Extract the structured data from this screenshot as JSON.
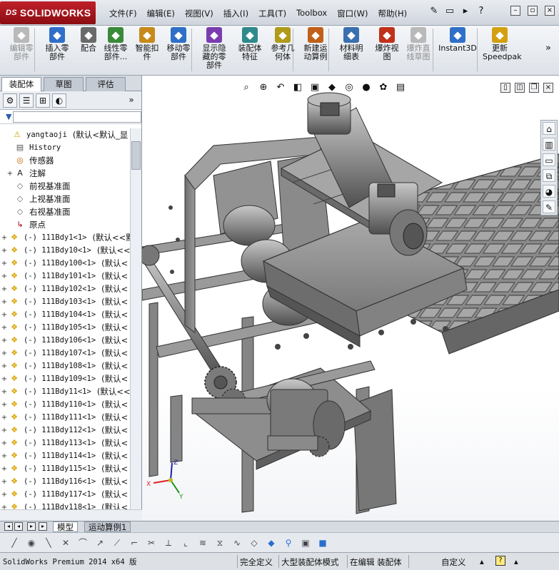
{
  "app": {
    "brand": "SOLIDWORKS",
    "brand_prefix": "DS"
  },
  "menu": [
    "文件(F)",
    "编辑(E)",
    "视图(V)",
    "插入(I)",
    "工具(T)",
    "Toolbox",
    "窗口(W)",
    "帮助(H)"
  ],
  "ribbon": {
    "buttons": [
      {
        "label": "编辑零\n部件",
        "icon": "edit-component-icon",
        "disabled": true
      },
      {
        "label": "插入零\n部件",
        "icon": "insert-component-icon",
        "disabled": false
      },
      {
        "label": "配合",
        "icon": "mate-icon",
        "disabled": false
      },
      {
        "label": "线性零\n部件...",
        "icon": "linear-pattern-icon",
        "disabled": false
      },
      {
        "label": "智能扣\n件",
        "icon": "smart-fastener-icon",
        "disabled": false
      },
      {
        "label": "移动零\n部件",
        "icon": "move-component-icon",
        "disabled": false
      },
      {
        "label": "显示隐\n藏的零\n部件",
        "icon": "show-hidden-icon",
        "disabled": false
      },
      {
        "label": "装配体\n特征",
        "icon": "assembly-feature-icon",
        "disabled": false
      },
      {
        "label": "参考几\n何体",
        "icon": "reference-geometry-icon",
        "disabled": false
      },
      {
        "label": "新建运\n动算例",
        "icon": "new-motion-study-icon",
        "disabled": false
      },
      {
        "label": "材料明\n细表",
        "icon": "bom-icon",
        "disabled": false
      },
      {
        "label": "爆炸视\n图",
        "icon": "exploded-view-icon",
        "disabled": false
      },
      {
        "label": "爆炸直\n线草图",
        "icon": "explode-line-sketch-icon",
        "disabled": true
      },
      {
        "label": "Instant3D",
        "icon": "instant3d-icon",
        "disabled": false
      },
      {
        "label": "更新\nSpeedpak",
        "icon": "speedpak-icon",
        "disabled": false
      }
    ]
  },
  "left_panel": {
    "tabs": [
      "装配体",
      "草图",
      "评估"
    ],
    "active_tab": "装配体",
    "root": {
      "name": "yangtaoji",
      "config": "(默认<默认_显"
    },
    "fixed_items": [
      {
        "label": "History",
        "icon": "history-icon",
        "expand": ""
      },
      {
        "label": "传感器",
        "icon": "sensor-icon",
        "expand": ""
      },
      {
        "label": "注解",
        "icon": "annotation-icon",
        "expand": "+"
      },
      {
        "label": "前视基准面",
        "icon": "plane-icon",
        "expand": ""
      },
      {
        "label": "上视基准面",
        "icon": "plane-icon",
        "expand": ""
      },
      {
        "label": "右视基准面",
        "icon": "plane-icon",
        "expand": ""
      },
      {
        "label": "原点",
        "icon": "origin-icon",
        "expand": ""
      }
    ],
    "components": [
      {
        "label": "(-) 111Bdy1<1>",
        "config": "(默认<<默"
      },
      {
        "label": "(-) 111Bdy10<1>",
        "config": "(默认<<"
      },
      {
        "label": "(-) 111Bdy100<1>",
        "config": "(默认<"
      },
      {
        "label": "(-) 111Bdy101<1>",
        "config": "(默认<"
      },
      {
        "label": "(-) 111Bdy102<1>",
        "config": "(默认<"
      },
      {
        "label": "(-) 111Bdy103<1>",
        "config": "(默认<"
      },
      {
        "label": "(-) 111Bdy104<1>",
        "config": "(默认<"
      },
      {
        "label": "(-) 111Bdy105<1>",
        "config": "(默认<"
      },
      {
        "label": "(-) 111Bdy106<1>",
        "config": "(默认<"
      },
      {
        "label": "(-) 111Bdy107<1>",
        "config": "(默认<"
      },
      {
        "label": "(-) 111Bdy108<1>",
        "config": "(默认<"
      },
      {
        "label": "(-) 111Bdy109<1>",
        "config": "(默认<"
      },
      {
        "label": "(-) 111Bdy11<1>",
        "config": "(默认<<"
      },
      {
        "label": "(-) 111Bdy110<1>",
        "config": "(默认<"
      },
      {
        "label": "(-) 111Bdy111<1>",
        "config": "(默认<"
      },
      {
        "label": "(-) 111Bdy112<1>",
        "config": "(默认<"
      },
      {
        "label": "(-) 111Bdy113<1>",
        "config": "(默认<"
      },
      {
        "label": "(-) 111Bdy114<1>",
        "config": "(默认<"
      },
      {
        "label": "(-) 111Bdy115<1>",
        "config": "(默认<"
      },
      {
        "label": "(-) 111Bdy116<1>",
        "config": "(默认<"
      },
      {
        "label": "(-) 111Bdy117<1>",
        "config": "(默认<"
      },
      {
        "label": "(-) 111Bdy118<1>",
        "config": "(默认<"
      }
    ]
  },
  "bottom_tabs": [
    "模型",
    "运动算例1"
  ],
  "triad": {
    "x": "X",
    "y": "Y",
    "z": "Z"
  },
  "status": {
    "product": "SolidWorks Premium 2014 x64 版",
    "definition": "完全定义",
    "mode": "大型装配体模式",
    "editing": "在编辑 装配体",
    "units": "自定义"
  },
  "colors": {
    "accent_red": "#b3141c",
    "model_gray": "#8f8f8f",
    "model_dark": "#4a4a4a"
  }
}
